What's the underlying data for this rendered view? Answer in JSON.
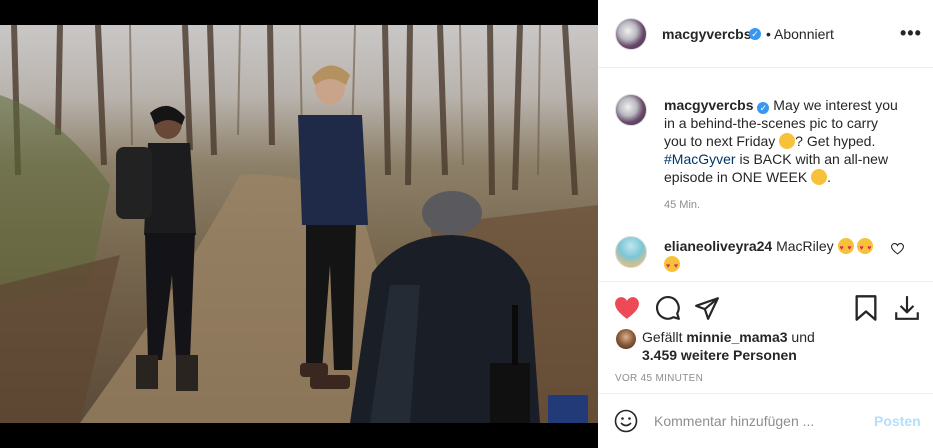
{
  "header": {
    "username": "macgyvercbs",
    "follow_status": "• Abonniert",
    "more_label": "•••"
  },
  "caption": {
    "username": "macgyvercbs",
    "text_part1": "May we interest you in a behind-the-scenes pic to carry you to next Friday",
    "text_part2": "? Get hyped.",
    "hashtag": "#MacGyver",
    "text_part3": "is BACK with an all-new episode in ONE WEEK",
    "text_part4": ".",
    "time": "45 Min."
  },
  "comment": {
    "username": "elianeoliveyra24",
    "text": "MacRiley"
  },
  "likes": {
    "prefix": "Gefällt",
    "user": "minnie_mama3",
    "middle": "und",
    "count": "3.459 weitere Personen"
  },
  "timestamp": "VOR 45 MINUTEN",
  "comment_input": {
    "placeholder": "Kommentar hinzufügen ...",
    "post_label": "Posten"
  },
  "colors": {
    "like_red": "#ed4956",
    "verified_blue": "#3897f0",
    "hashtag_blue": "#00376b",
    "post_disabled": "#b2dffc"
  },
  "icons": [
    "verified-badge-icon",
    "heart-filled-icon",
    "comment-icon",
    "share-icon",
    "bookmark-icon",
    "download-icon",
    "emoji-icon",
    "heart-outline-icon"
  ]
}
